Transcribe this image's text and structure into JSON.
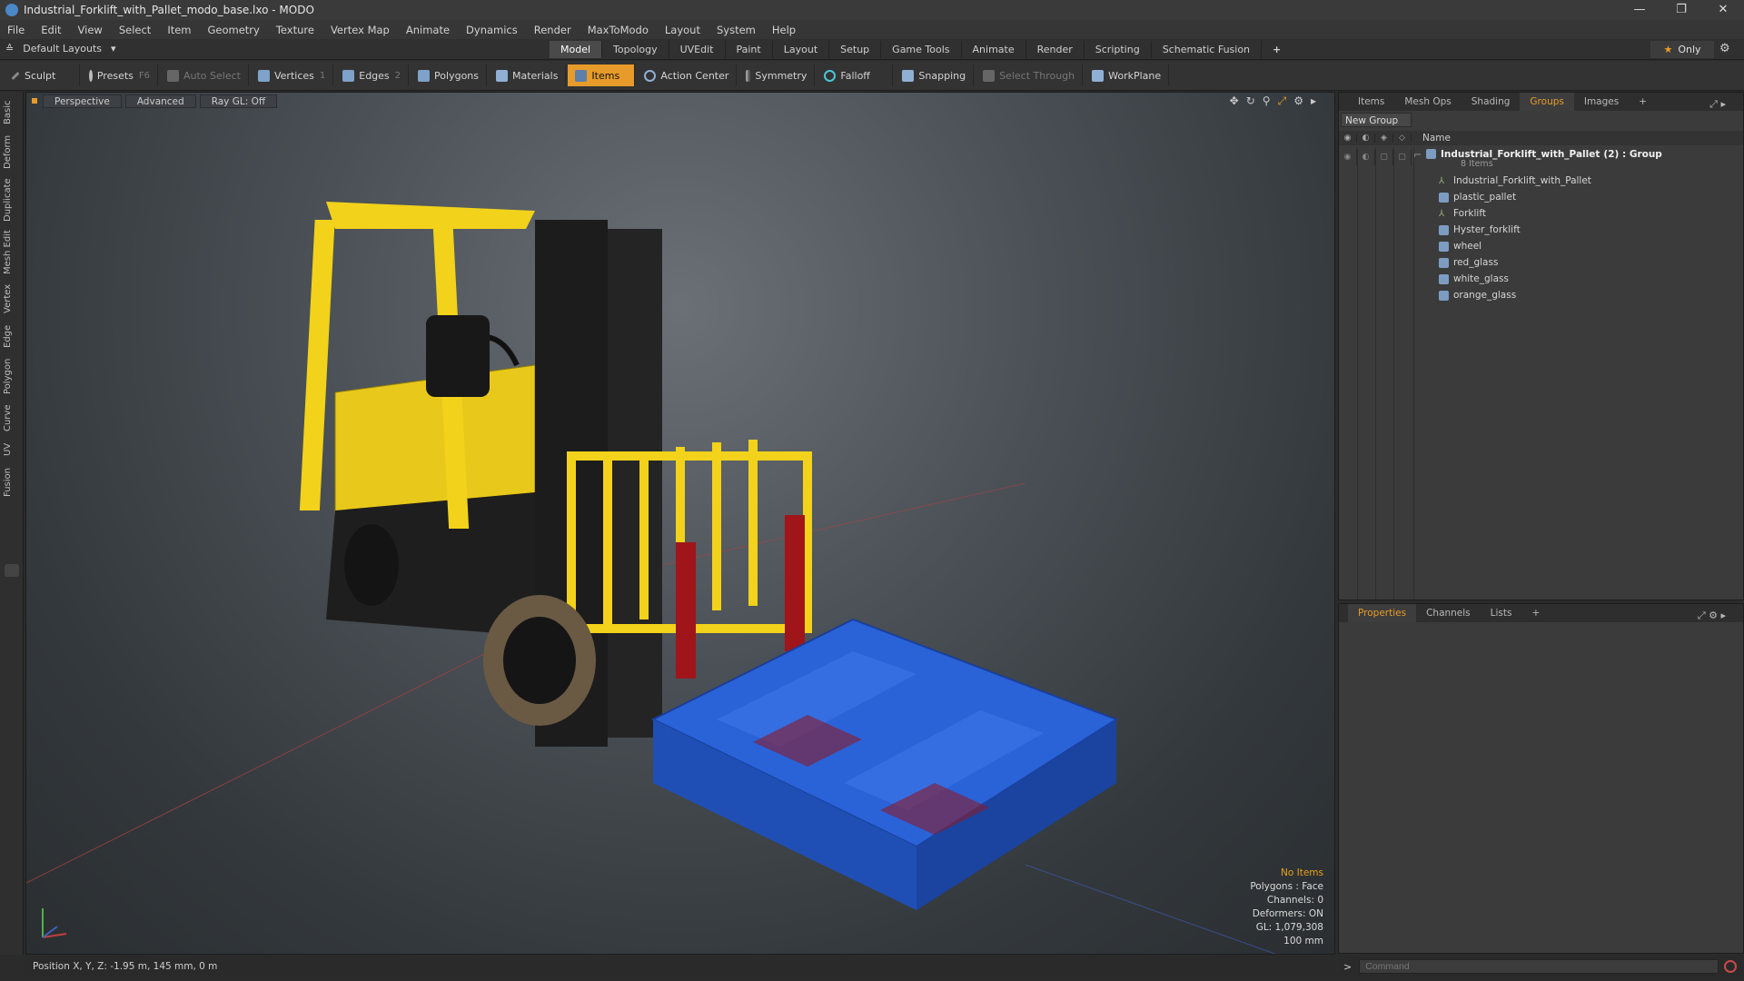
{
  "window": {
    "title": "Industrial_Forklift_with_Pallet_modo_base.lxo - MODO",
    "buttons": [
      "—",
      "❐",
      "✕"
    ]
  },
  "menu": [
    "File",
    "Edit",
    "View",
    "Select",
    "Item",
    "Geometry",
    "Texture",
    "Vertex Map",
    "Animate",
    "Dynamics",
    "Render",
    "MaxToModo",
    "Layout",
    "System",
    "Help"
  ],
  "layout_bar": {
    "layout_name": "Default Layouts",
    "tabs": [
      "Model",
      "Topology",
      "UVEdit",
      "Paint",
      "Layout",
      "Setup",
      "Game Tools",
      "Animate",
      "Render",
      "Scripting",
      "Schematic Fusion"
    ],
    "active_tab": "Model",
    "add": "+",
    "only_label": "Only"
  },
  "toolbar": {
    "sculpt": "Sculpt",
    "presets": "Presets",
    "presets_key": "F6",
    "auto_select": "Auto Select",
    "vertices": "Vertices",
    "vertices_num": "1",
    "edges": "Edges",
    "edges_num": "2",
    "polygons": "Polygons",
    "materials": "Materials",
    "items": "Items",
    "action_center": "Action Center",
    "symmetry": "Symmetry",
    "falloff": "Falloff",
    "snapping": "Snapping",
    "select_through": "Select Through",
    "workplane": "WorkPlane"
  },
  "left_tabs": [
    "Basic",
    "Deform",
    "Duplicate",
    "Mesh Edit",
    "Vertex",
    "Edge",
    "Polygon",
    "Curve",
    "UV",
    "Fusion"
  ],
  "viewport": {
    "view": "Perspective",
    "shading": "Advanced",
    "raygl": "Ray GL: Off",
    "hud": {
      "no_items": "No Items",
      "polygons": "Polygons : Face",
      "channels": "Channels: 0",
      "deformers": "Deformers: ON",
      "gl": "GL: 1,079,308",
      "scale": "100 mm"
    }
  },
  "status": "Position X, Y, Z:  -1.95 m, 145 mm, 0 m",
  "panel_top": {
    "tabs": [
      "Items",
      "Mesh Ops",
      "Shading",
      "Groups",
      "Images",
      "+"
    ],
    "active": "Groups",
    "new_group": "New Group",
    "name_header": "Name",
    "group": {
      "name": "Industrial_Forklift_with_Pallet",
      "suffix": "(2) : Group",
      "count": "8 Items"
    },
    "items": [
      {
        "name": "Industrial_Forklift_with_Pallet",
        "icon": "locator-icon"
      },
      {
        "name": "plastic_pallet",
        "icon": "mesh-icon"
      },
      {
        "name": "Forklift",
        "icon": "locator-icon"
      },
      {
        "name": "Hyster_forklift",
        "icon": "mesh-icon"
      },
      {
        "name": "wheel",
        "icon": "mesh-icon"
      },
      {
        "name": "red_glass",
        "icon": "mesh-icon"
      },
      {
        "name": "white_glass",
        "icon": "mesh-icon"
      },
      {
        "name": "orange_glass",
        "icon": "mesh-icon"
      }
    ]
  },
  "panel_bottom": {
    "tabs": [
      "Properties",
      "Channels",
      "Lists",
      "+"
    ],
    "active": "Properties"
  },
  "command": {
    "arrow": ">",
    "placeholder": "Command"
  },
  "colors": {
    "accent": "#e79b2a",
    "forklift_yellow": "#f2d21a",
    "pallet_blue": "#2a62d8",
    "fork_red": "#a0151a"
  }
}
